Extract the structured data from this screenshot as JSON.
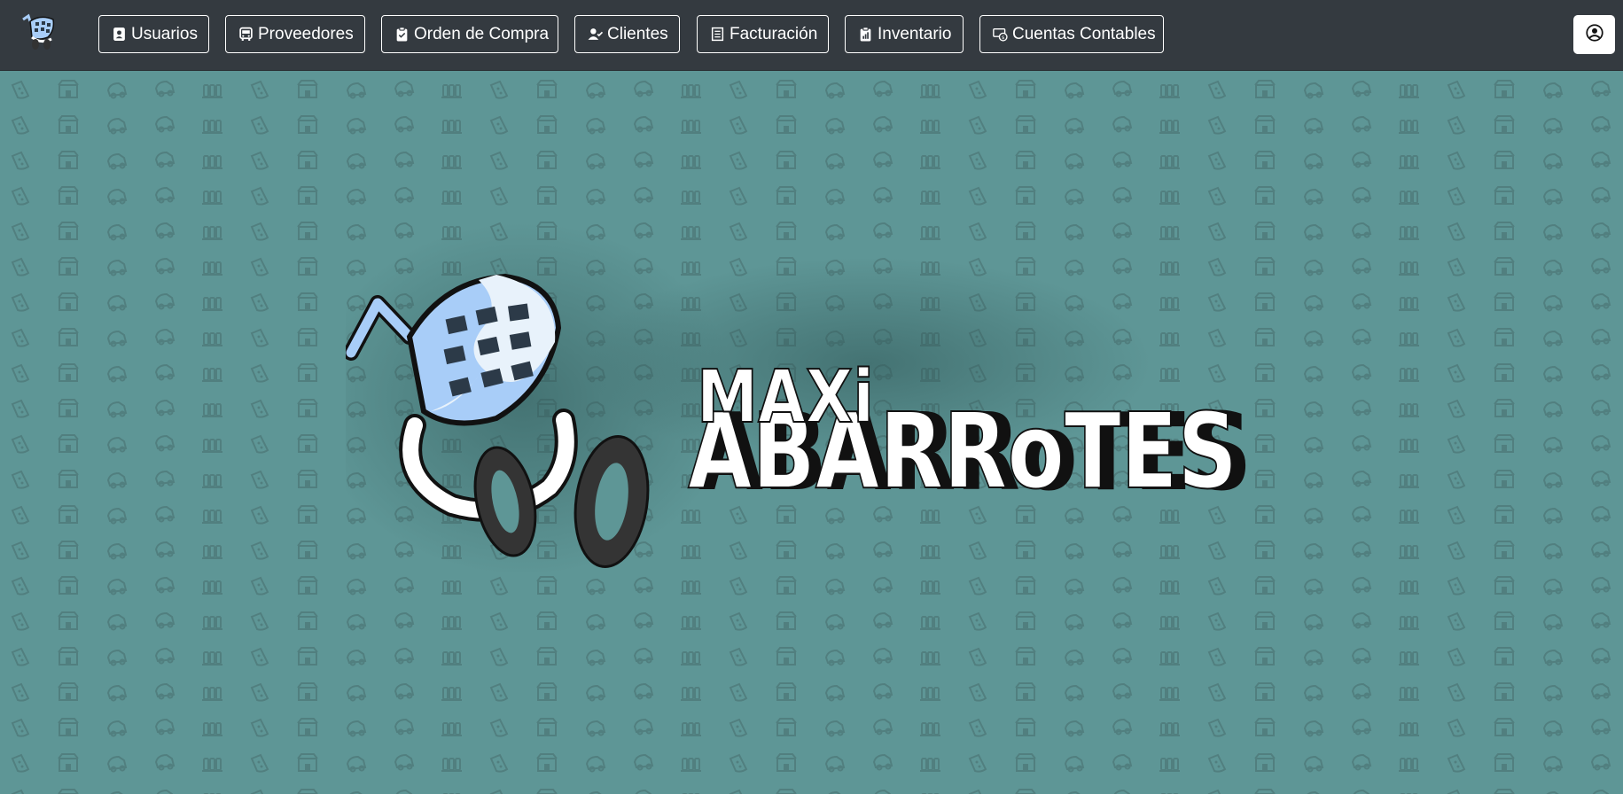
{
  "navbar": {
    "brand_icon": "shopping-cart-logo-icon",
    "items": [
      {
        "label": "Usuarios",
        "icon": "user-badge-icon"
      },
      {
        "label": "Proveedores",
        "icon": "bus-icon"
      },
      {
        "label": "Orden de Compra",
        "icon": "clipboard-icon"
      },
      {
        "label": "Clientes",
        "icon": "user-check-icon"
      },
      {
        "label": "Facturación",
        "icon": "receipt-icon"
      },
      {
        "label": "Inventario",
        "icon": "clipboard-chart-icon"
      },
      {
        "label": "Cuentas Contables",
        "icon": "cash-coin-icon"
      }
    ],
    "user_icon": "user-circle-icon"
  },
  "hero": {
    "logo_line1": "MAXi",
    "logo_line2": "ABARRoTES"
  },
  "colors": {
    "navbar_bg": "#343a40",
    "hero_bg": "#5e9696",
    "cart_blue": "#a8cdf8",
    "wheel_dark": "#343434"
  }
}
